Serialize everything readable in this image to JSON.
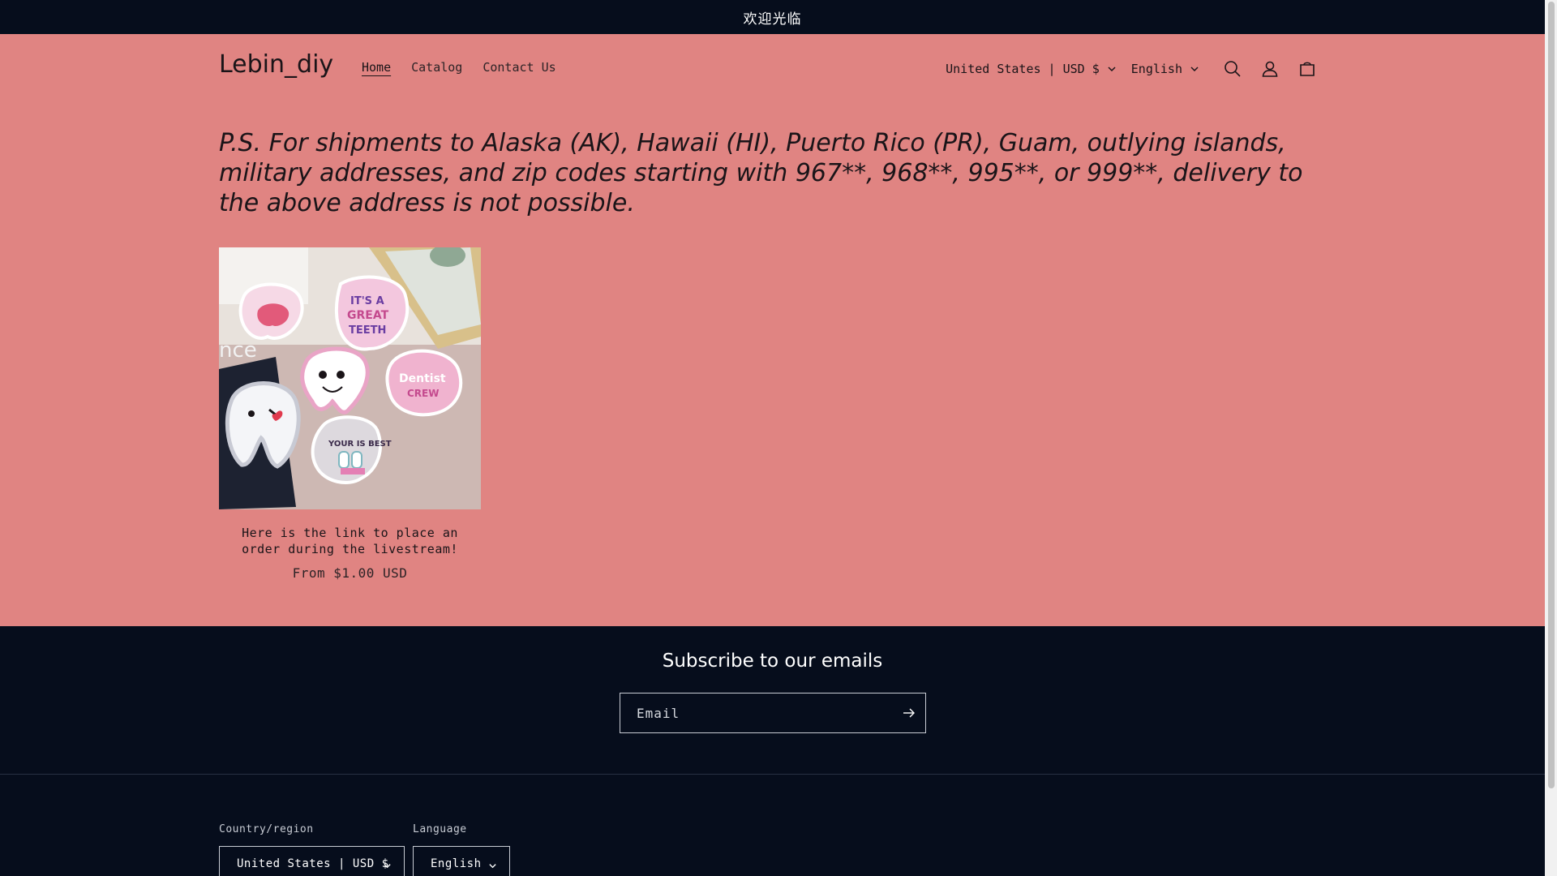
{
  "announcement": {
    "text": "欢迎光临"
  },
  "header": {
    "logo": "Lebin_diy",
    "nav": [
      {
        "label": "Home",
        "active": true
      },
      {
        "label": "Catalog",
        "active": false
      },
      {
        "label": "Contact Us",
        "active": false
      }
    ],
    "country_selector": "United States | USD $",
    "language_selector": "English",
    "icons": [
      "search-icon",
      "account-icon",
      "cart-icon"
    ]
  },
  "notice": {
    "text": "P.S. For shipments to Alaska (AK), Hawaii (HI), Puerto Rico (PR), Guam, outlying islands, military addresses, and zip codes starting with 967**, 968**, 995**, or 999**, delivery to the above address is not possible."
  },
  "products": [
    {
      "title": "Here is the link to place an order during the livestream!",
      "price": "From $1.00 USD",
      "image_label": "dental-themed-patches-photo"
    }
  ],
  "footer": {
    "subscribe_title": "Subscribe to our emails",
    "email_placeholder": "Email",
    "country_label": "Country/region",
    "country_value": "United States | USD $",
    "language_label": "Language",
    "language_value": "English"
  },
  "colors": {
    "page_background": "#e08482",
    "dark_background": "#060d1c",
    "text": "#1a1418"
  }
}
